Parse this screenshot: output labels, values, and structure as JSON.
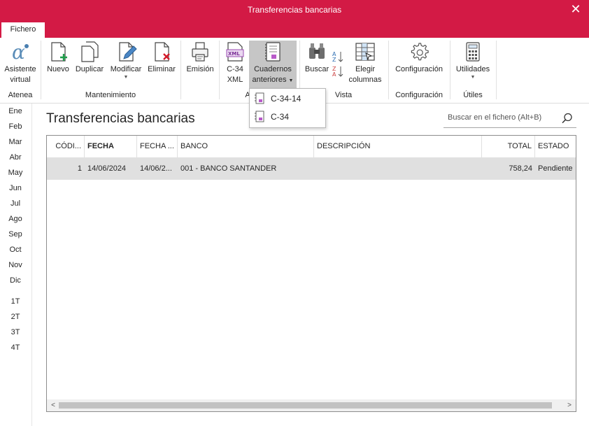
{
  "window": {
    "title": "Transferencias bancarias",
    "close_glyph": "✕"
  },
  "tabs": [
    {
      "label": "Fichero"
    }
  ],
  "ribbon": {
    "buttons": {
      "asistente": {
        "line1": "Asistente",
        "line2": "virtual",
        "icon": "alpha-icon"
      },
      "nuevo": {
        "label": "Nuevo",
        "icon": "new-document-icon"
      },
      "duplicar": {
        "label": "Duplicar",
        "icon": "duplicate-icon"
      },
      "modificar": {
        "label": "Modificar",
        "icon": "edit-document-icon"
      },
      "eliminar": {
        "label": "Eliminar",
        "icon": "delete-document-icon"
      },
      "emision": {
        "label": "Emisión",
        "icon": "printer-icon"
      },
      "c34xml": {
        "line1": "C-34",
        "line2": "XML",
        "icon": "xml-file-icon"
      },
      "cuadernos": {
        "line1": "Cuadernos",
        "line2": "anteriores",
        "icon": "notebook-icon"
      },
      "buscar": {
        "label": "Buscar",
        "icon": "binoculars-icon"
      },
      "elegir": {
        "line1": "Elegir",
        "line2": "columnas",
        "icon": "columns-icon"
      },
      "configuracion": {
        "label": "Configuración",
        "icon": "gear-icon"
      },
      "utilidades": {
        "label": "Utilidades",
        "icon": "calculator-icon"
      }
    },
    "groups": {
      "atenea": "Atenea",
      "mantenimiento": "Mantenimiento",
      "acciones": "A",
      "vista": "Vista",
      "configuracion": "Configuración",
      "utiles": "Útiles"
    }
  },
  "dropdown": {
    "items": [
      {
        "label": "C-34-14"
      },
      {
        "label": "C-34"
      }
    ]
  },
  "sidebar": {
    "months": [
      "Ene",
      "Feb",
      "Mar",
      "Abr",
      "May",
      "Jun",
      "Jul",
      "Ago",
      "Sep",
      "Oct",
      "Nov",
      "Dic"
    ],
    "quarters": [
      "1T",
      "2T",
      "3T",
      "4T"
    ]
  },
  "main": {
    "title": "Transferencias bancarias",
    "search_placeholder": "Buscar en el fichero (Alt+B)"
  },
  "table": {
    "columns": [
      "CÓDI...",
      "FECHA",
      "FECHA ...",
      "BANCO",
      "DESCRIPCIÓN",
      "TOTAL",
      "ESTADO"
    ],
    "rows": [
      {
        "codigo": "1",
        "fecha": "14/06/2024",
        "fecha2": "14/06/2...",
        "banco": "001 - BANCO SANTANDER",
        "descripcion": "",
        "total": "758,24",
        "estado": "Pendiente"
      }
    ]
  },
  "colors": {
    "brand": "#d31a45",
    "selected_row": "#e0e0e0",
    "pressed_button": "#c6c6c6"
  }
}
